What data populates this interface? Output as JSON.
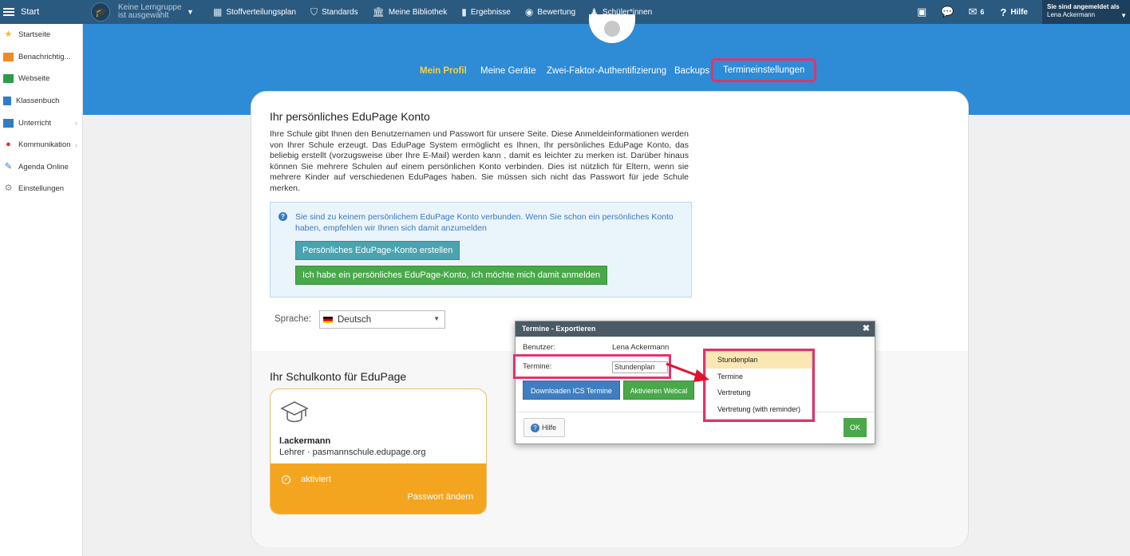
{
  "topbar": {
    "start_label": "Start",
    "learning_group": "Keine Lerngruppe ist ausgewählt",
    "items": [
      {
        "label": "Stoffverteilungsplan",
        "icon": "map-icon"
      },
      {
        "label": "Standards",
        "icon": "shield-icon"
      },
      {
        "label": "Meine Bibliothek",
        "icon": "library-icon"
      },
      {
        "label": "Ergebnisse",
        "icon": "bar-chart-icon"
      },
      {
        "label": "Bewertung",
        "icon": "grade-icon"
      },
      {
        "label": "Schüler*innen",
        "icon": "students-icon"
      }
    ],
    "message_count": "6",
    "help_label": "Hilfe",
    "logged_in_label": "Sie sind angemeldet als",
    "user_name": "Lena Ackermann"
  },
  "sidebar": {
    "items": [
      {
        "label": "Startseite",
        "icon": "star-icon",
        "color": "#f2b81b"
      },
      {
        "label": "Benachrichtig...",
        "icon": "mail-icon",
        "color": "#f08a24"
      },
      {
        "label": "Webseite",
        "icon": "home-icon",
        "color": "#2e9a4a"
      },
      {
        "label": "Klassenbuch",
        "icon": "book-icon",
        "color": "#2e7ec6"
      },
      {
        "label": "Unterricht",
        "icon": "briefcase-icon",
        "color": "#2e7ec6"
      },
      {
        "label": "Kommunikation",
        "icon": "chat-icon",
        "color": "#d9342b"
      },
      {
        "label": "Agenda Online",
        "icon": "pen-icon",
        "color": "#2e7ec6"
      },
      {
        "label": "Einstellungen",
        "icon": "gear-icon",
        "color": "#888888"
      }
    ]
  },
  "profile_tabs": [
    {
      "label": "Mein Profil"
    },
    {
      "label": "Meine Geräte"
    },
    {
      "label": "Zwei-Faktor-Authentifizierung"
    },
    {
      "label": "Backups"
    },
    {
      "label": "Termineinstellungen"
    }
  ],
  "main": {
    "title": "Ihr persönliches EduPage Konto",
    "intro": "Ihre Schule gibt Ihnen den Benutzernamen und Passwort für unsere Seite. Diese Anmeldeinformationen werden von Ihrer Schule erzeugt. Das EduPage System ermöglicht es Ihnen, Ihr persönliches EduPage Konto, das beliebig erstellt (vorzugsweise über Ihre E-Mail) werden kann , damit es leichter zu merken ist. Darüber hinaus können Sie mehrere Schulen auf einem persönlichen Konto verbinden. Dies ist nützlich für Eltern, wenn sie mehrere Kinder auf verschiedenen EduPages haben. Sie müssen sich nicht das Passwort für jede Schule merken.",
    "info_message": "Sie sind zu keinem persönlichem EduPage Konto verbunden. Wenn Sie schon ein persönliches Konto haben, empfehlen wir Ihnen sich damit anzumelden",
    "create_button": "Persönliches EduPage-Konto erstellen",
    "login_button": "Ich habe ein persönliches EduPage-Konto, Ich möchte mich damit anmelden",
    "language_label": "Sprache:",
    "language_value": "Deutsch",
    "school_account_title": "Ihr Schulkonto für EduPage",
    "account": {
      "username": "l.ackermann",
      "role_school": "Lehrer · pasmannschule.edupage.org",
      "status": "aktiviert",
      "change_password": "Passwort ändern"
    }
  },
  "dialog": {
    "title": "Termine - Exportieren",
    "user_label": "Benutzer:",
    "user_value": "Lena Ackermann",
    "termine_label": "Termine:",
    "termine_value": "Stundenplan",
    "download_button": "Downloaden ICS Termine",
    "webcal_button": "Aktivieren Webcal",
    "help_button": "Hilfe",
    "ok_button": "OK",
    "options": [
      "Stundenplan",
      "Termine",
      "Vertretung",
      "Vertretung (with reminder)"
    ]
  },
  "colors": {
    "topbar": "#2b5a80",
    "banner": "#2e8bd6",
    "highlight": "#e2336b",
    "active_tab": "#f7d23e",
    "account_footer": "#f4a51f"
  }
}
